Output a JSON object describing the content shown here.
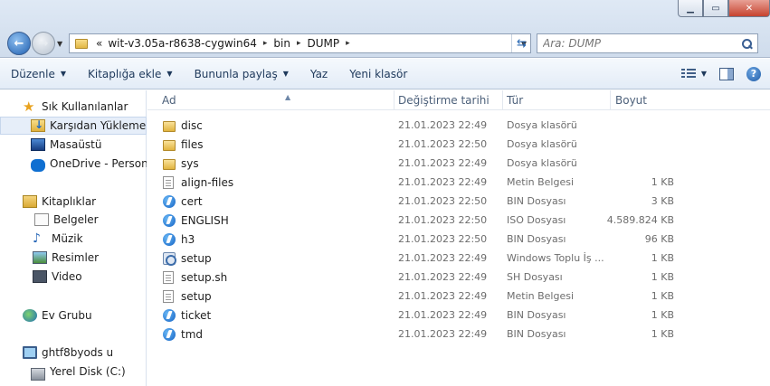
{
  "address": {
    "crumbs": [
      "wit-v3.05a-r8638-cygwin64",
      "bin",
      "DUMP"
    ],
    "overflow": "«"
  },
  "search": {
    "placeholder": "Ara: DUMP"
  },
  "toolbar": {
    "organize": "Düzenle",
    "include_library": "Kitaplığa ekle",
    "share_with": "Bununla paylaş",
    "burn": "Yaz",
    "new_folder": "Yeni klasör"
  },
  "nav": {
    "favorites": "Sık Kullanılanlar",
    "downloads": "Karşıdan Yüklemeler",
    "desktop": "Masaüstü",
    "onedrive": "OneDrive - Personal",
    "libraries": "Kitaplıklar",
    "documents": "Belgeler",
    "music": "Müzik",
    "pictures": "Resimler",
    "videos": "Video",
    "homegroup": "Ev Grubu",
    "computer": "ghtf8byods u",
    "local_disk": "Yerel Disk (C:)"
  },
  "columns": {
    "name": "Ad",
    "modified": "Değiştirme tarihi",
    "type": "Tür",
    "size": "Boyut"
  },
  "files": [
    {
      "name": "disc",
      "date": "21.01.2023 22:49",
      "type": "Dosya klasörü",
      "size": "",
      "icon": "folder-icon"
    },
    {
      "name": "files",
      "date": "21.01.2023 22:50",
      "type": "Dosya klasörü",
      "size": "",
      "icon": "folder-icon"
    },
    {
      "name": "sys",
      "date": "21.01.2023 22:49",
      "type": "Dosya klasörü",
      "size": "",
      "icon": "folder-icon"
    },
    {
      "name": "align-files",
      "date": "21.01.2023 22:49",
      "type": "Metin Belgesi",
      "size": "1 KB",
      "icon": "text-file-icon"
    },
    {
      "name": "cert",
      "date": "21.01.2023 22:50",
      "type": "BIN Dosyası",
      "size": "3 KB",
      "icon": "bin-file-icon"
    },
    {
      "name": "ENGLISH",
      "date": "21.01.2023 22:50",
      "type": "ISO Dosyası",
      "size": "4.589.824 KB",
      "icon": "bin-file-icon"
    },
    {
      "name": "h3",
      "date": "21.01.2023 22:50",
      "type": "BIN Dosyası",
      "size": "96 KB",
      "icon": "bin-file-icon"
    },
    {
      "name": "setup",
      "date": "21.01.2023 22:49",
      "type": "Windows Toplu İş ...",
      "size": "1 KB",
      "icon": "batch-file-icon"
    },
    {
      "name": "setup.sh",
      "date": "21.01.2023 22:49",
      "type": "SH Dosyası",
      "size": "1 KB",
      "icon": "text-file-icon"
    },
    {
      "name": "setup",
      "date": "21.01.2023 22:49",
      "type": "Metin Belgesi",
      "size": "1 KB",
      "icon": "text-file-icon"
    },
    {
      "name": "ticket",
      "date": "21.01.2023 22:49",
      "type": "BIN Dosyası",
      "size": "1 KB",
      "icon": "bin-file-icon"
    },
    {
      "name": "tmd",
      "date": "21.01.2023 22:49",
      "type": "BIN Dosyası",
      "size": "1 KB",
      "icon": "bin-file-icon"
    }
  ]
}
